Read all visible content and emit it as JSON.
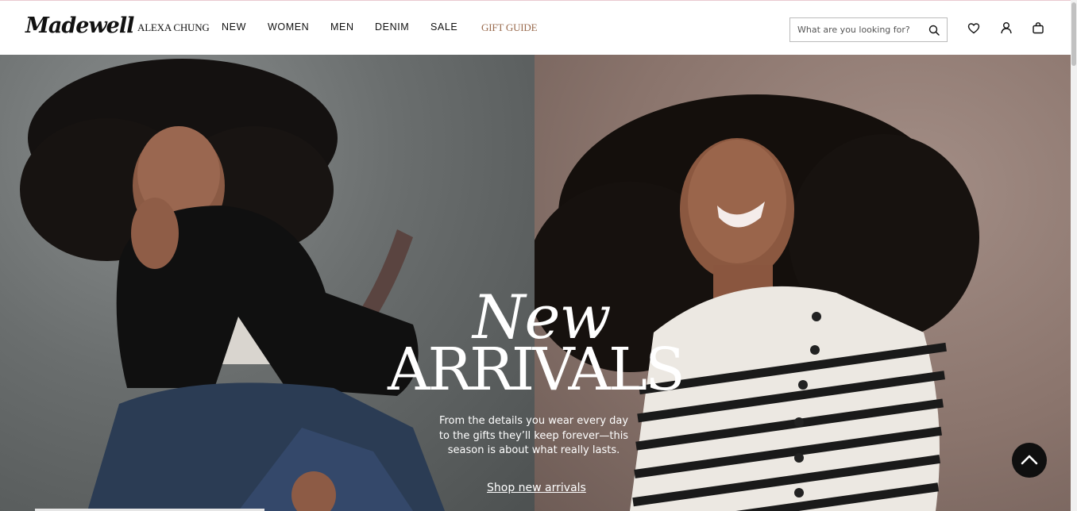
{
  "brand": {
    "logo_text": "Madewell"
  },
  "nav": {
    "items": [
      {
        "label": "ALEXA CHUNG"
      },
      {
        "label": "NEW"
      },
      {
        "label": "WOMEN"
      },
      {
        "label": "MEN"
      },
      {
        "label": "DENIM"
      },
      {
        "label": "SALE"
      },
      {
        "label": "GIFT GUIDE"
      }
    ]
  },
  "search": {
    "placeholder": "What are you looking for?",
    "value": ""
  },
  "header_icons": [
    "heart-icon",
    "account-icon",
    "bag-icon"
  ],
  "hero": {
    "headline_script": "New",
    "headline_caps": "ARRIVALS",
    "subtext": "From the details you wear every day to the gifts they’ll keep forever—this season is about what really lasts.",
    "cta": "Shop new arrivals"
  },
  "colors": {
    "gift_guide": "#9a6b4e",
    "text": "#111111",
    "back_to_top_bg": "#0f0f0f"
  }
}
